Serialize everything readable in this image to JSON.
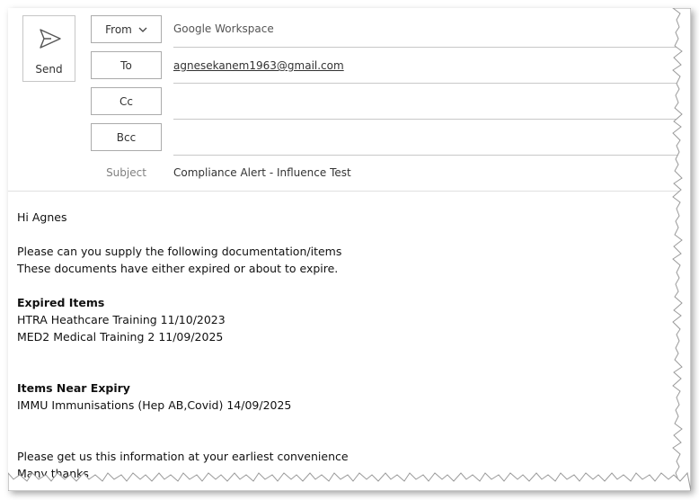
{
  "compose": {
    "send_label": "Send",
    "from_label": "From",
    "from_value": "Google Workspace",
    "to_label": "To",
    "to_value": "agnesekanem1963@gmail.com",
    "cc_label": "Cc",
    "cc_value": "",
    "bcc_label": "Bcc",
    "bcc_value": "",
    "subject_label": "Subject",
    "subject_value": "Compliance Alert - Influence Test",
    "icons": {
      "send": "send-icon",
      "from_dropdown": "chevron-down-icon"
    }
  },
  "body": {
    "greeting": "Hi Agnes",
    "request_line1": "Please can you supply the following documentation/items",
    "request_line2": "These documents have either expired or about to expire.",
    "expired_heading": "Expired Items",
    "expired_items": [
      "HTRA Heathcare Training 11/10/2023",
      "MED2 Medical Training 2 11/09/2025"
    ],
    "near_expiry_heading": "Items Near Expiry",
    "near_expiry_items": [
      "IMMU Immunisations (Hep AB,Covid) 14/09/2025"
    ],
    "closing_line": "Please get us this information at your earliest convenience",
    "signoff": "Many thanks"
  }
}
